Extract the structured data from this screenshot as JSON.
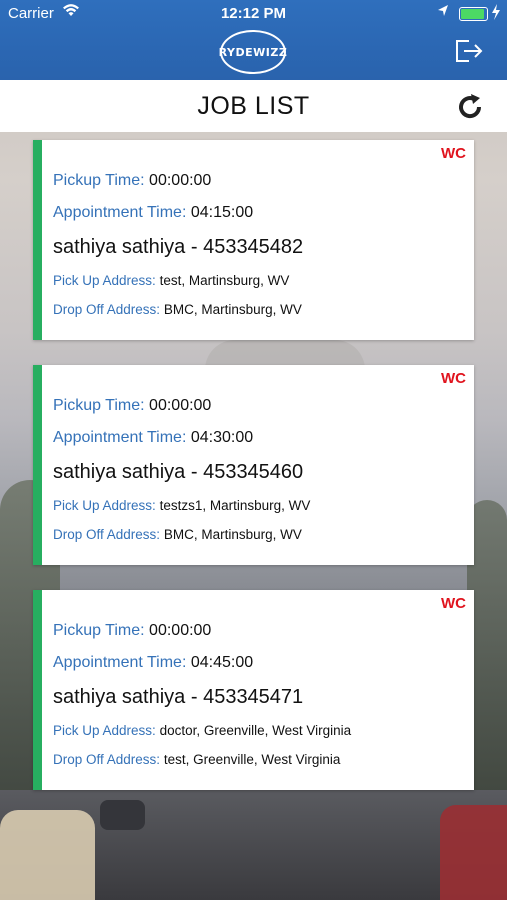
{
  "status": {
    "carrier": "Carrier",
    "time": "12:12 PM"
  },
  "header": {
    "logo_text": "RYDEWIZZ",
    "title": "JOB LIST",
    "icons": [
      "logout-icon",
      "refresh-icon"
    ]
  },
  "labels": {
    "pickup_time": "Pickup Time:",
    "appointment_time": "Appointment Time:",
    "pickup_address": "Pick Up Address:",
    "dropoff_address": "Drop Off Address:"
  },
  "colors": {
    "header_blue": "#2b67b3",
    "label_blue": "#3572b8",
    "status_green": "#27ae60",
    "badge_red": "#e0141e"
  },
  "jobs": [
    {
      "badge": "WC",
      "pickup_time": "00:00:00",
      "appointment_time": "04:15:00",
      "name_id": "sathiya sathiya - 453345482",
      "pickup_address": "test, Martinsburg, WV",
      "dropoff_address": "BMC, Martinsburg, WV"
    },
    {
      "badge": "WC",
      "pickup_time": "00:00:00",
      "appointment_time": "04:30:00",
      "name_id": "sathiya sathiya - 453345460",
      "pickup_address": "testzs1, Martinsburg, WV",
      "dropoff_address": "BMC, Martinsburg, WV"
    },
    {
      "badge": "WC",
      "pickup_time": "00:00:00",
      "appointment_time": "04:45:00",
      "name_id": "sathiya sathiya - 453345471",
      "pickup_address": "doctor, Greenville, West Virginia",
      "dropoff_address": "test, Greenville, West Virginia"
    }
  ]
}
